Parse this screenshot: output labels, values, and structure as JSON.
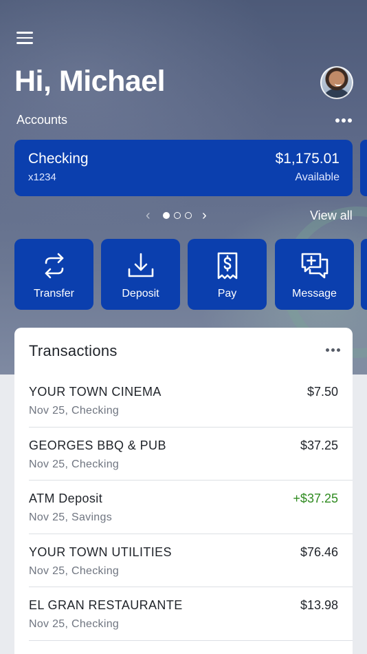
{
  "header": {
    "greeting": "Hi, Michael",
    "accounts_label": "Accounts"
  },
  "account": {
    "name": "Checking",
    "number": "x1234",
    "balance": "$1,175.01",
    "balance_label": "Available",
    "brand_color": "#0b3fae"
  },
  "pager": {
    "prev": "‹",
    "next": "›",
    "view_all": "View all"
  },
  "actions": [
    {
      "label": "Transfer",
      "icon": "transfer-icon"
    },
    {
      "label": "Deposit",
      "icon": "deposit-icon"
    },
    {
      "label": "Pay",
      "icon": "pay-icon"
    },
    {
      "label": "Message",
      "icon": "message-icon"
    }
  ],
  "transactions": {
    "title": "Transactions",
    "credit_color": "#2e8a1f",
    "items": [
      {
        "merchant": "YOUR TOWN CINEMA",
        "meta": "Nov 25, Checking",
        "amount": "$7.50"
      },
      {
        "merchant": "GEORGES BBQ & PUB",
        "meta": "Nov 25, Checking",
        "amount": "$37.25"
      },
      {
        "merchant": "ATM Deposit",
        "meta": "Nov 25, Savings",
        "amount": "+$37.25"
      },
      {
        "merchant": "YOUR TOWN UTILITIES",
        "meta": "Nov 25, Checking",
        "amount": "$76.46"
      },
      {
        "merchant": "EL GRAN RESTAURANTE",
        "meta": "Nov 25, Checking",
        "amount": "$13.98"
      }
    ]
  }
}
